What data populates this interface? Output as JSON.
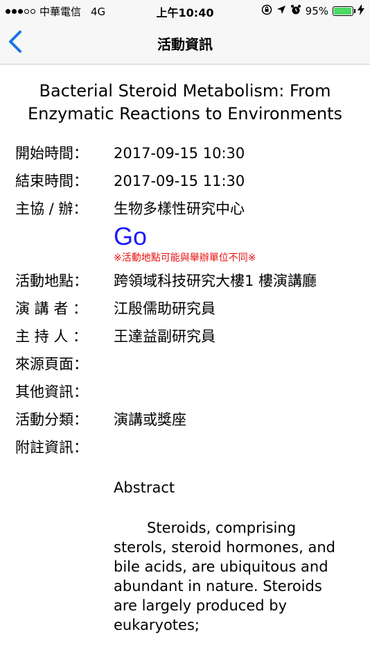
{
  "status_bar": {
    "carrier": "中華電信",
    "network": "4G",
    "time": "上午10:40",
    "battery": "95%",
    "battery_level": 0.95
  },
  "nav": {
    "title": "活動資訊"
  },
  "event": {
    "title": "Bacterial Steroid Metabolism: From Enzymatic Reactions to Environments",
    "fields": {
      "start_label": "開始時間：",
      "start_value": "2017-09-15 10:30",
      "end_label": "結束時間：",
      "end_value": "2017-09-15 11:30",
      "organizer_label": "主協 / 辦：",
      "organizer_value": "生物多樣性研究中心",
      "go_label": "Go",
      "go_note": "※活動地點可能與舉辦單位不同※",
      "location_label": "活動地點：",
      "location_value": "跨領域科技研究大樓1 樓演講廳",
      "speaker_label": "演 講 者 ：",
      "speaker_value": "江殷儒助研究員",
      "host_label": "主 持 人 ：",
      "host_value": "王達益副研究員",
      "source_label": "來源頁面：",
      "other_label": "其他資訊：",
      "category_label": "活動分類：",
      "category_value": "演講或獎座",
      "notes_label": "附註資訊："
    },
    "abstract": {
      "heading": "Abstract",
      "body": "Steroids, comprising sterols, steroid hormones, and bile acids, are ubiquitous and abundant in nature. Steroids are largely produced by eukaryotes;"
    }
  }
}
